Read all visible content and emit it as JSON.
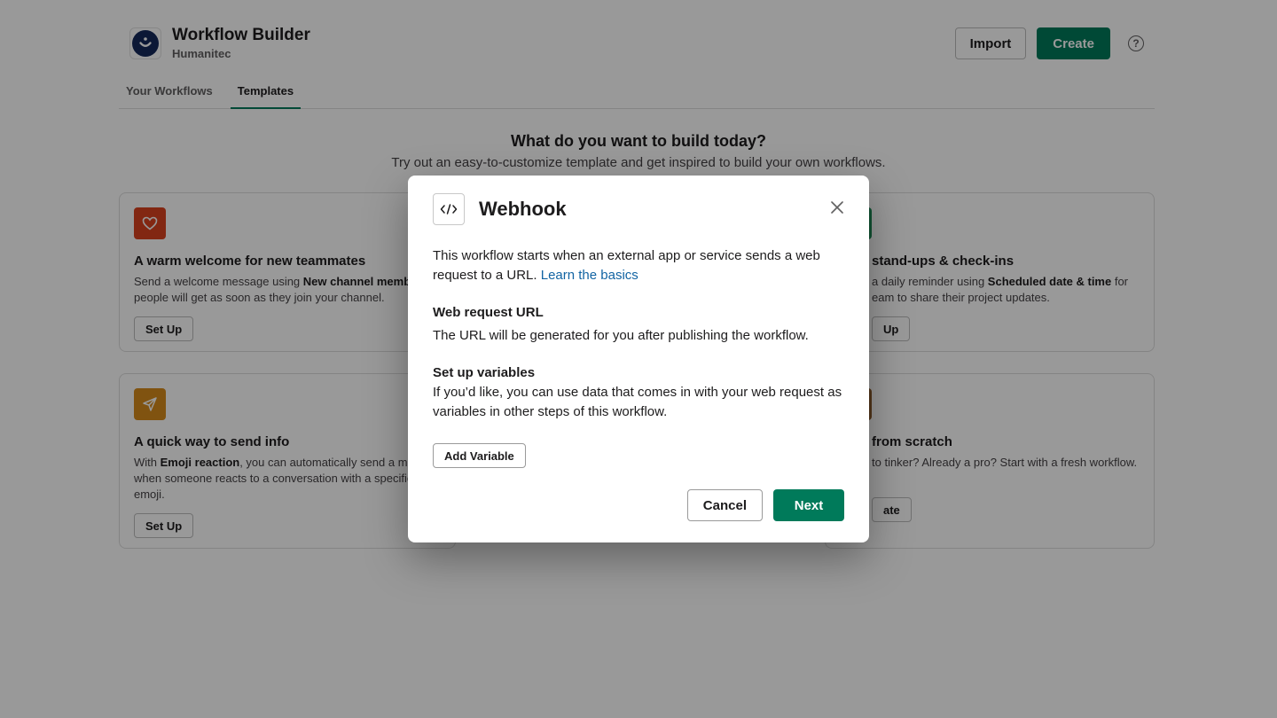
{
  "app": {
    "title": "Workflow Builder",
    "workspace": "Humanitec",
    "import_label": "Import",
    "create_label": "Create",
    "help_glyph": "?"
  },
  "tabs": [
    {
      "label": "Your Workflows",
      "active": false
    },
    {
      "label": "Templates",
      "active": true
    }
  ],
  "hero": {
    "title": "What do you want to build today?",
    "subtitle": "Try out an easy-to-customize template and get inspired to build your own workflows."
  },
  "cards": [
    {
      "title": "A warm welcome for new teammates",
      "desc_pre": "Send a welcome message using ",
      "desc_bold": "New channel member",
      "desc_post": " people will get as soon as they join your channel.",
      "button": "Set Up",
      "icon": "heart-icon",
      "color": "#d9421e"
    },
    {
      "title": "stand-ups & check-ins",
      "desc_pre": "a daily reminder using ",
      "desc_bold": "Scheduled date & time",
      "desc_post": " for eam to share their project updates.",
      "button": "Up",
      "icon": "calendar-icon",
      "color": "#1d8a56"
    },
    {
      "title": "A quick way to send info",
      "desc_pre": "With ",
      "desc_bold": "Emoji reaction",
      "desc_post": ", you can automatically send a mes when someone reacts to a conversation with a specific emoji.",
      "button": "Set Up",
      "icon": "paper-plane-icon",
      "color": "#d58a1c"
    },
    {
      "title": "from scratch",
      "desc_pre": "to tinker? Already a pro? Start with a fresh workflow.",
      "desc_bold": "",
      "desc_post": "",
      "button": "ate",
      "icon": "pencil-icon",
      "color": "#8a5a2c"
    }
  ],
  "modal": {
    "title": "Webhook",
    "icon": "code-icon",
    "intro_text": "This workflow starts when an external app or service sends a web request to a URL.",
    "learn_link": "Learn the basics",
    "url_heading": "Web request URL",
    "url_text": "The URL will be generated for you after publishing the workflow.",
    "vars_heading": "Set up variables",
    "vars_text": "If you’d like, you can use data that comes in with your web request as variables in other steps of this workflow.",
    "add_variable_label": "Add Variable",
    "cancel_label": "Cancel",
    "next_label": "Next"
  },
  "colors": {
    "accent": "#007a5a",
    "link": "#1264a3",
    "overlay": "rgba(0,0,0,0.4)"
  }
}
